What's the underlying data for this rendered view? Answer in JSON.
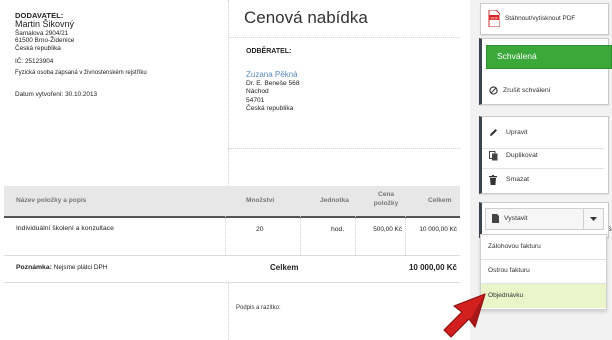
{
  "supplier": {
    "title": "DODAVATEL:",
    "name": "Martin Šikovný",
    "street": "Šamalova 2904/21",
    "city": "61500 Brno-Židenice",
    "country": "Česká republika",
    "ic": "IČ: 25123904",
    "note": "Fyzická osoba zapsaná v živnostenském rejstříku",
    "created": "Datum vytvoření: 30.10.2013"
  },
  "document": {
    "title": "Cenová nabídka"
  },
  "customer": {
    "title": "ODBĚRATEL:",
    "name": "Zuzana Pěkná",
    "street": "Dr. E. Beneše 568",
    "city": "Náchod",
    "zip": "54701",
    "country": "Česká republika"
  },
  "table": {
    "headers": {
      "name": "Název položky a popis",
      "qty": "Množství",
      "unit": "Jednotka",
      "price_line1": "Cena",
      "price_line2": "položky",
      "total": "Celkem"
    },
    "rows": [
      {
        "name": "Individuální školení a konzultace",
        "qty": "20",
        "unit": "hod.",
        "price": "500,00 Kč",
        "total": "10 000,00 Kč"
      }
    ],
    "note_label": "Poznámka:",
    "note_text": "Nejsme plátci DPH",
    "total_label": "Celkem",
    "total_value": "10 000,00 Kč",
    "signature": "Podpis a razítko:"
  },
  "sidebar": {
    "download_pdf": "Stáhnout/vytisknout PDF",
    "approved": "Schválená",
    "cancel_approval": "Zrušit schválení",
    "edit": "Upravit",
    "duplicate": "Duplikovat",
    "delete": "Smazat",
    "issue": "Vystavit",
    "issue_menu": [
      "Zálohovou fakturu",
      "Ostrou fakturu",
      "Objednávku"
    ],
    "side_hint": "Sc"
  },
  "colors": {
    "green": "#3aa93a",
    "link": "#5b8bbf",
    "highlight": "#eaf5c9",
    "cursor": "#d2201f"
  }
}
